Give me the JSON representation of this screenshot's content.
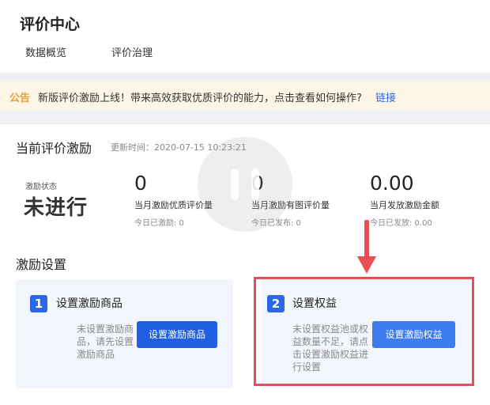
{
  "header": {
    "title": "评价中心",
    "tabs": [
      {
        "label": "数据概览"
      },
      {
        "label": "评价治理"
      }
    ]
  },
  "notice": {
    "tag": "公告",
    "message": "新版评价激励上线！带来高效获取优质评价的能力，点击查看如何操作?",
    "link": "链接"
  },
  "incentive": {
    "title": "当前评价激励",
    "updated": "更新时间：2020-07-15 10:23:21",
    "status_label": "激励状态",
    "status_value": "未进行",
    "metrics": [
      {
        "value": "0",
        "label": "当月激励优质评价量",
        "sub": "今日已激励: 0"
      },
      {
        "value": "0",
        "label": "当月激励有图评价量",
        "sub": "今日已发布: 0"
      },
      {
        "value": "0.00",
        "label": "当月发放激励金额",
        "sub": "今日已发放: 0.00"
      }
    ]
  },
  "settings": {
    "title": "激励设置",
    "steps": [
      {
        "number": "1",
        "title": "设置激励商品",
        "desc": "未设置激励商品，请先设置激励商品",
        "button": "设置激励商品"
      },
      {
        "number": "2",
        "title": "设置权益",
        "desc": "未设置权益池或权益数量不足，请点击设置激励权益进行设置",
        "button": "设置激励权益"
      }
    ]
  },
  "colors": {
    "accent": "#2b67e8",
    "highlight": "#e84f55",
    "notice_bg": "#fdf6e6",
    "notice_tag": "#e9a030"
  },
  "icons": {
    "play_overlay": "pause-overlay-icon",
    "arrow": "arrow-down-icon"
  }
}
